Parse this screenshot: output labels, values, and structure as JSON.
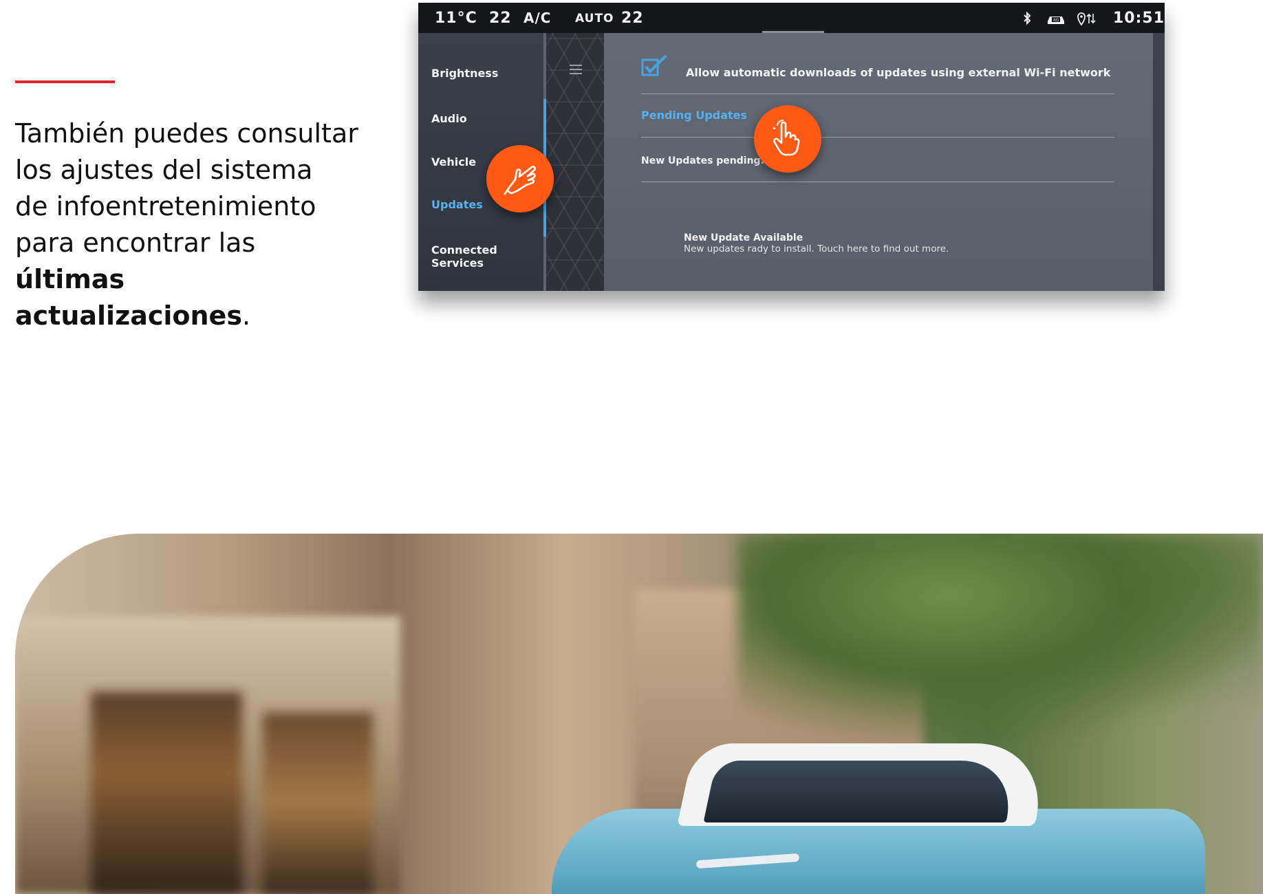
{
  "intro": {
    "line1": "También puedes consultar",
    "line2": "los ajustes del sistema",
    "line3": "de infoentretenimiento",
    "line4_prefix": "para encontrar las ",
    "line4_bold": "últimas",
    "line5_bold": "actualizaciones",
    "line5_suffix": "."
  },
  "statusbar": {
    "temperature": "11°C",
    "left_temp": "22",
    "ac": "A/C",
    "mode": "AUTO",
    "right_temp": "22",
    "clock": "10:51",
    "icons": [
      "bluetooth-icon",
      "4g-car-icon",
      "location-data-icon"
    ]
  },
  "sidebar": {
    "items": [
      {
        "label": "Brightness"
      },
      {
        "label": "Audio"
      },
      {
        "label": "Vehicle"
      },
      {
        "label": "Updates",
        "active": true
      },
      {
        "label": "Connected Services"
      }
    ]
  },
  "content": {
    "wifi_checkbox_label": "Allow automatic downloads of updates using external Wi-Fi network",
    "wifi_checked": true,
    "pending_title": "Pending Updates",
    "pending_text": "New Updates pending.",
    "update_title": "New Update Available",
    "update_subtitle": "New updates rady to install. Touch here to find out more."
  },
  "colors": {
    "accent_red": "#e0262a",
    "touch_orange": "#ff5a14",
    "active_blue": "#55b0ee"
  },
  "photo": {
    "subject": "light-blue compact SUV with white roof driving on a city street"
  }
}
